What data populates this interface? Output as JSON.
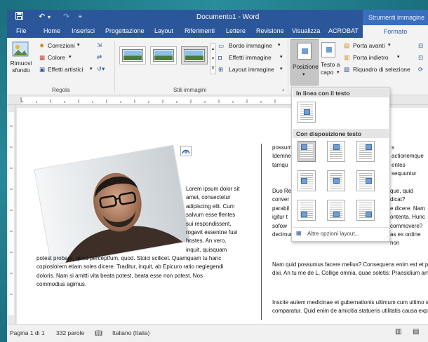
{
  "window": {
    "title": "Documento1 - Word",
    "context_title": "Strumenti immagine"
  },
  "quick_access": {
    "save_icon": "save-icon",
    "undo_icon": "undo-icon",
    "redo_icon": "redo-icon",
    "customize_icon": "chevron-down-icon"
  },
  "tabs": [
    {
      "label": "File"
    },
    {
      "label": "Home"
    },
    {
      "label": "Inserisci"
    },
    {
      "label": "Progettazione"
    },
    {
      "label": "Layout"
    },
    {
      "label": "Riferimenti"
    },
    {
      "label": "Lettere"
    },
    {
      "label": "Revisione"
    },
    {
      "label": "Visualizza"
    },
    {
      "label": "ACROBAT"
    },
    {
      "label": "Formato"
    }
  ],
  "ribbon": {
    "rimuovi_sfondo": "Rimuovi sfondo",
    "correzioni": "Correzioni",
    "colore": "Colore",
    "effetti_artistici": "Effetti artistici",
    "regola_label": "Regola",
    "stili_label": "Stili immagini",
    "bordo_immagine": "Bordo immagine",
    "effetti_immagine": "Effetti immagine",
    "layout_immagine": "Layout immagine",
    "posizione": "Posizione",
    "testo_a_capo": "Testo a capo",
    "porta_avanti": "Porta avanti",
    "porta_indietro": "Porta indietro",
    "riquadro_selezione": "Riquadro di selezione"
  },
  "gallery": {
    "in_linea_header": "In linea con il testo",
    "con_disposizione_header": "Con disposizione testo",
    "altre_opzioni": "Altre opzioni layout..."
  },
  "document": {
    "wrap_lines": [
      "Lorem ipsum dolor sit",
      "amet, consectetur",
      "adipiscing elit. Cum",
      "salvum esse flentes",
      "sui respondissent,",
      "rogavit essentne fusi",
      "hostes. An vero,",
      "inquit, quisquam"
    ],
    "full_lines": [
      "potest probare, quod perceptfum, quod. Stoici scilicet. Quamquam tu hanc",
      "copiosiorem etiam soles dicere. Traditur, inquit, ab Epicuro ratio neglegendi",
      "doloris. Nam si amitti vita beata potest, beata esse non potest. Nos",
      "commodius agimus."
    ],
    "right_col": {
      "p1": [
        "possum",
        "Idemne",
        "tamqu"
      ],
      "p1_right": [
        "s actionemque",
        "entes sequuntur"
      ],
      "p2_left": [
        "Duo Re",
        "conver",
        "parabil",
        "igitur t",
        "sofow",
        "decimum annum in spelunca lacet."
      ],
      "p2_right": [
        "que, quid dicat?",
        "e dicere. Nam",
        "ontenta. Hunc",
        "commovere?",
        "as ex ordine non"
      ],
      "p3": [
        "Nam quid possumus facere melius? Consequens enim est et post oritur,",
        "dixi. An tu me de L. Collige omnia, quae soletis: Praesidium amicorum."
      ],
      "p4": [
        "Inscite autem medicinae et gubernationis ultimum cum ultimo sapientiae",
        "comparatur. Quid enim de amicitia statueris utilitatis causa expetenda vides."
      ]
    }
  },
  "status": {
    "page": "Pagina 1 di 1",
    "words": "332 parole",
    "language": "Italiano (Italia)"
  },
  "colors": {
    "title_bar": "#2b579a",
    "ribbon": "#f3f3f3",
    "context_tab": "#3a6fbf"
  }
}
